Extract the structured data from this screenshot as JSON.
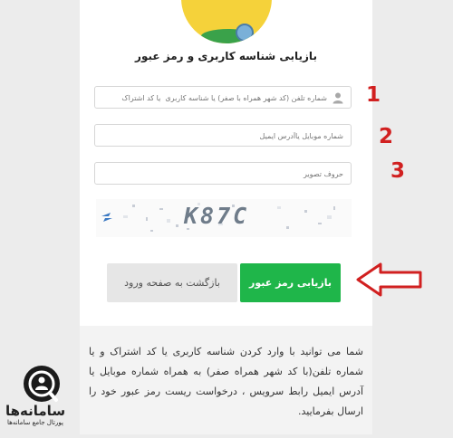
{
  "form": {
    "title": "بازیابی شناسه کاربری و رمز عبور",
    "field1_placeholder": "شماره تلفن (کد شهر همراه با صفر) یا شناسه کاربری  یا کد اشتراک",
    "field2_placeholder": "شماره موبایل یاآدرس ایمیل",
    "field3_placeholder": "حروف تصویر",
    "captcha_text": "K87C",
    "primary_button": "بازیابی رمز عبور",
    "secondary_button": "بازگشت به صفحه ورود",
    "help": "شما می توانید با وارد کردن شناسه کاربری یا کد اشتراک و یا شماره تلفن(با کد شهر همراه صفر) به همراه شماره موبایل یا آدرس ایمیل رابط سرویس ، درخواست ریست رمز عبور خود را ارسال بفرمایید."
  },
  "annotations": {
    "n1": "1",
    "n2": "2",
    "n3": "3"
  },
  "brand": {
    "name": "سامانه‌ها",
    "tagline": "پورتال جامع سامانه‌ها"
  },
  "colors": {
    "primary": "#1fb64a",
    "annotation": "#d12020",
    "logo_yellow": "#f5d23a"
  },
  "icons": {
    "field1": "user-icon",
    "pointer": "arrow-left-icon"
  }
}
